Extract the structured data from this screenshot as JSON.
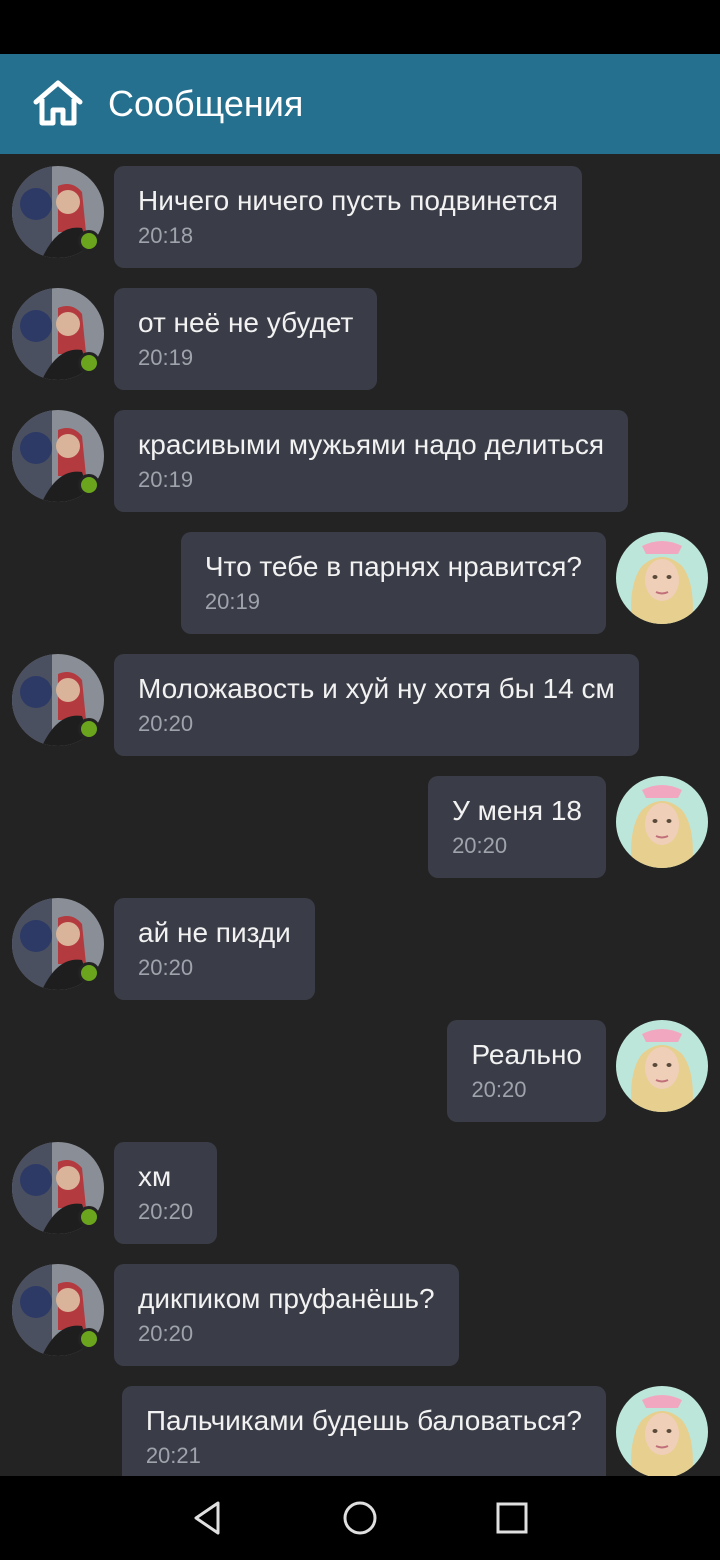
{
  "header": {
    "title": "Сообщения",
    "icon": "home-icon"
  },
  "colors": {
    "header_bg": "#25708f",
    "bubble_bg": "#3a3d47",
    "online": "#6aa51d",
    "background": "#232323"
  },
  "messages": [
    {
      "side": "in",
      "text": "Ничего ничего пусть подвинется",
      "time": "20:18"
    },
    {
      "side": "in",
      "text": "от неё не убудет",
      "time": "20:19"
    },
    {
      "side": "in",
      "text": "красивыми мужьями надо делиться",
      "time": "20:19"
    },
    {
      "side": "out",
      "text": "Что тебе в парнях нравится?",
      "time": "20:19"
    },
    {
      "side": "in",
      "text": "Моложавость и хуй ну хотя бы 14 см",
      "time": "20:20"
    },
    {
      "side": "out",
      "text": "У меня 18",
      "time": "20:20"
    },
    {
      "side": "in",
      "text": "ай не пизди",
      "time": "20:20"
    },
    {
      "side": "out",
      "text": "Реально",
      "time": "20:20"
    },
    {
      "side": "in",
      "text": "хм",
      "time": "20:20"
    },
    {
      "side": "in",
      "text": "дикпиком пруфанёшь?",
      "time": "20:20"
    },
    {
      "side": "out",
      "text": "Пальчиками будешь баловаться?",
      "time": "20:21"
    }
  ],
  "nav": {
    "back": "back-icon",
    "home": "home-circle-icon",
    "recents": "recents-icon"
  }
}
